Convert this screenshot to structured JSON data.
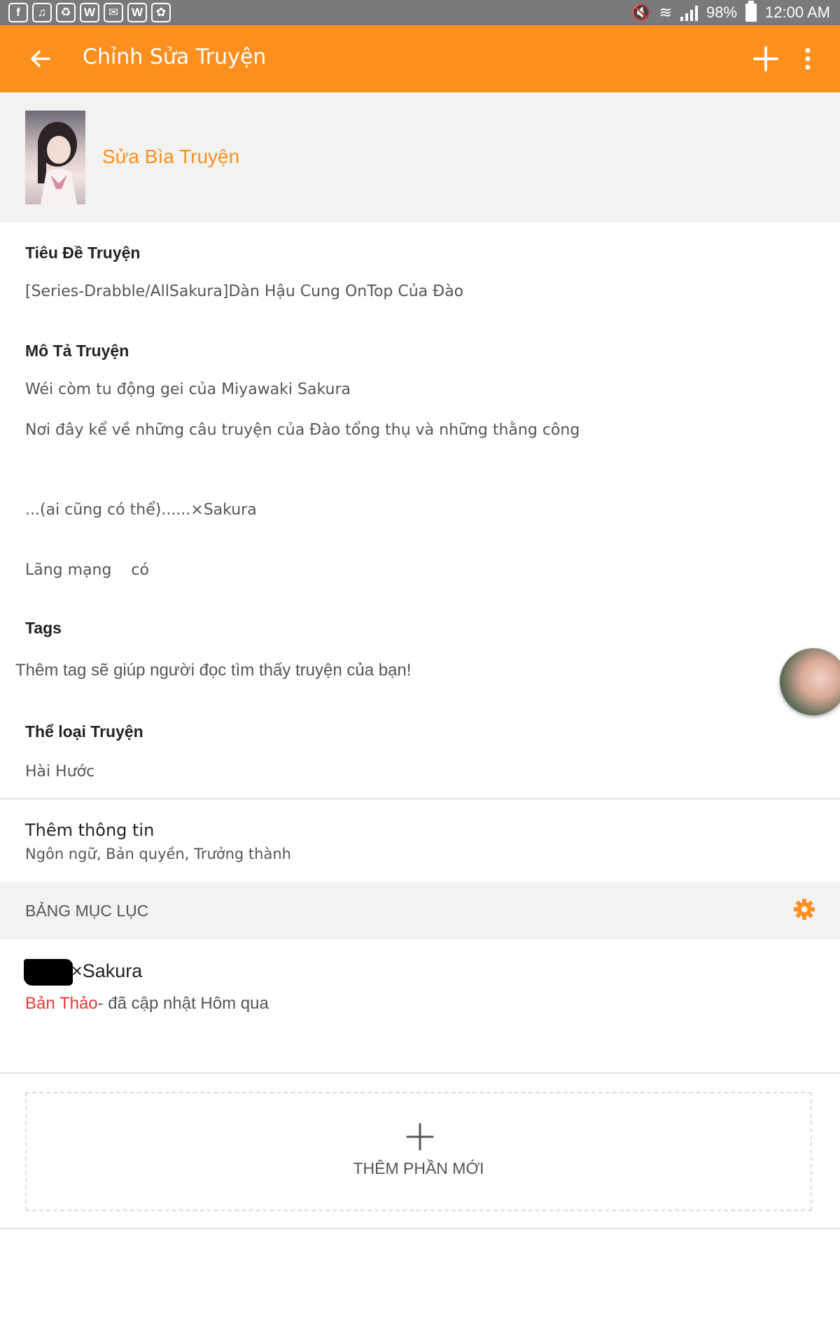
{
  "status_bar": {
    "notif_icons": [
      "facebook-icon",
      "phone-icon",
      "recycle-icon",
      "wattpad-icon",
      "messenger-icon",
      "wattpad-icon",
      "game-icon"
    ],
    "notif_glyphs": [
      "f",
      "♫",
      "♻",
      "W",
      "✉",
      "W",
      "✿"
    ],
    "battery": "98%",
    "time": "12:00 AM"
  },
  "toolbar": {
    "title": "Chỉnh Sửa Truyện",
    "accent_color": "#ff8f1f"
  },
  "cover": {
    "edit_label": "Sửa Bìa Truyện"
  },
  "story": {
    "title_label": "Tiêu Đề Truyện",
    "title_value": "[Series-Drabble/AllSakura]Dàn Hậu Cung OnTop Của Đào",
    "desc_label": "Mô Tả Truyện",
    "desc_line1": "Wéi còm tu động gei của Miyawaki Sakura",
    "desc_line2": "Nơi đây kể về những câu truyện của Đào tổng thụ và những thằng công",
    "desc_line3": "...(ai cũng có thể)......×Sakura",
    "desc_line4": "Lãng mạng    có",
    "tags_label": "Tags",
    "tags_hint": "Thêm tag sẽ giúp người đọc tìm thấy truyện của bạn!",
    "category_label": "Thể loại Truyện",
    "category_value": "Hài Hước"
  },
  "more_info": {
    "title": "Thêm thông tin",
    "subtitle": "Ngôn ngữ, Bản quyền, Trưởng thành"
  },
  "toc": {
    "header": "BẢNG MỤC LỤC",
    "parts": [
      {
        "title": "×Sakura",
        "status": "Bản Thảo",
        "updated": "- đã cập nhật Hôm qua"
      }
    ],
    "add_part_label": "THÊM PHẦN MỚI"
  }
}
